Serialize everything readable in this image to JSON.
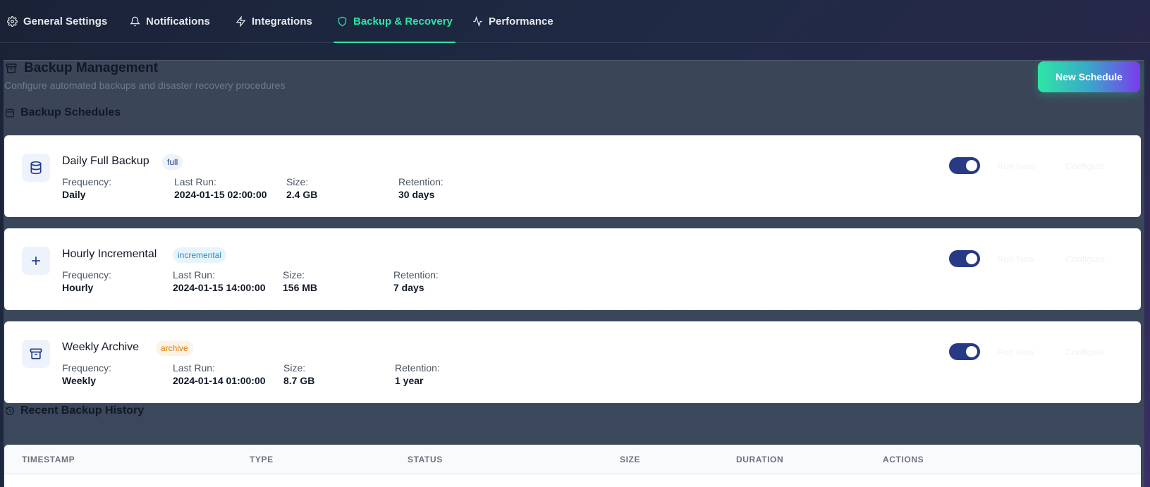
{
  "tabs": [
    {
      "label": "General Settings",
      "icon": "gear-icon"
    },
    {
      "label": "Notifications",
      "icon": "bell-icon"
    },
    {
      "label": "Integrations",
      "icon": "bolt-icon"
    },
    {
      "label": "Backup & Recovery",
      "icon": "shield-icon",
      "active": true
    },
    {
      "label": "Performance",
      "icon": "activity-icon"
    }
  ],
  "header": {
    "title": "Backup Management",
    "subtitle": "Configure automated backups and disaster recovery procedures",
    "new_button": "New Schedule"
  },
  "schedules_section": {
    "title": "Backup Schedules"
  },
  "schedules": [
    {
      "name": "Daily Full Backup",
      "badge": "full",
      "icon": "database-icon",
      "frequency_label": "Frequency:",
      "frequency": "Daily",
      "last_run_label": "Last Run:",
      "last_run": "2024-01-15 02:00:00",
      "size_label": "Size:",
      "size": "2.4 GB",
      "retention_label": "Retention:",
      "retention": "30 days",
      "enabled": true,
      "run_now": "Run Now",
      "configure": "Configure"
    },
    {
      "name": "Hourly Incremental",
      "badge": "incremental",
      "icon": "plus-icon",
      "frequency_label": "Frequency:",
      "frequency": "Hourly",
      "last_run_label": "Last Run:",
      "last_run": "2024-01-15 14:00:00",
      "size_label": "Size:",
      "size": "156 MB",
      "retention_label": "Retention:",
      "retention": "7 days",
      "enabled": true,
      "run_now": "Run Now",
      "configure": "Configure"
    },
    {
      "name": "Weekly Archive",
      "badge": "archive",
      "icon": "archive-icon",
      "frequency_label": "Frequency:",
      "frequency": "Weekly",
      "last_run_label": "Last Run:",
      "last_run": "2024-01-14 01:00:00",
      "size_label": "Size:",
      "size": "8.7 GB",
      "retention_label": "Retention:",
      "retention": "1 year",
      "enabled": true,
      "run_now": "Run Now",
      "configure": "Configure"
    }
  ],
  "history_section": {
    "title": "Recent Backup History"
  },
  "history_table": {
    "columns": [
      "TIMESTAMP",
      "TYPE",
      "STATUS",
      "SIZE",
      "DURATION",
      "ACTIONS"
    ]
  },
  "colors": {
    "accent": "#2ee6a6",
    "toggle_on": "#283a85",
    "card_bg": "#ffffff"
  }
}
